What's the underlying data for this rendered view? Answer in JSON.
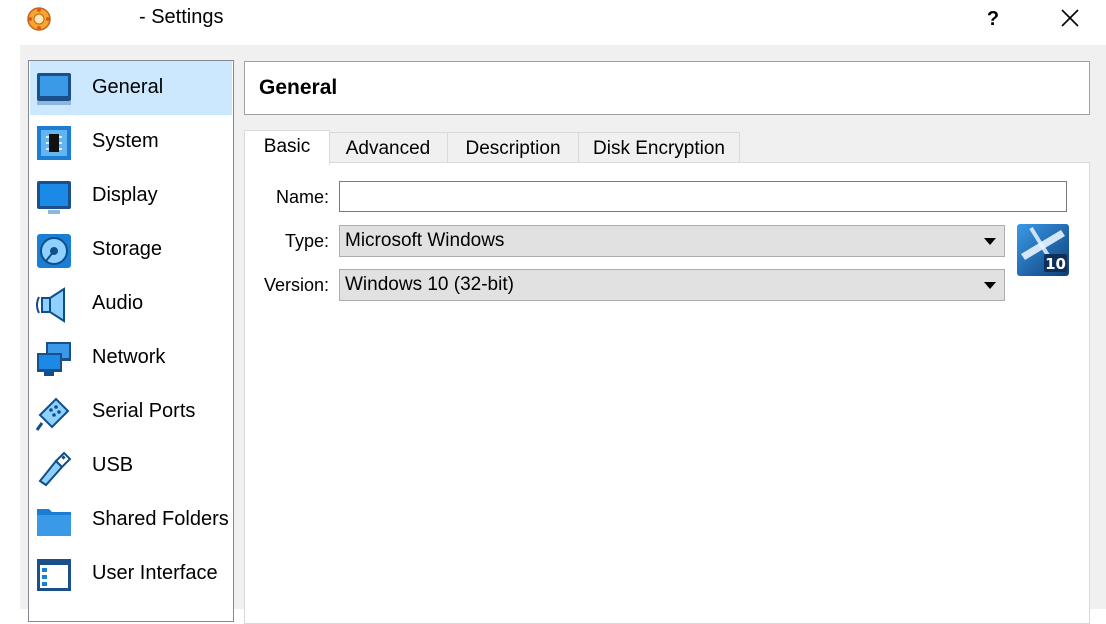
{
  "window": {
    "title": "- Settings",
    "help_label": "?",
    "icon": "virtualbox-icon"
  },
  "sidebar": {
    "items": [
      {
        "label": "General",
        "icon": "general-icon",
        "selected": true
      },
      {
        "label": "System",
        "icon": "system-chip-icon"
      },
      {
        "label": "Display",
        "icon": "display-monitor-icon"
      },
      {
        "label": "Storage",
        "icon": "storage-disk-icon"
      },
      {
        "label": "Audio",
        "icon": "audio-speaker-icon"
      },
      {
        "label": "Network",
        "icon": "network-icon"
      },
      {
        "label": "Serial Ports",
        "icon": "serial-ports-icon"
      },
      {
        "label": "USB",
        "icon": "usb-icon"
      },
      {
        "label": "Shared Folders",
        "icon": "shared-folder-icon"
      },
      {
        "label": "User Interface",
        "icon": "user-interface-icon"
      }
    ]
  },
  "page": {
    "title": "General"
  },
  "tabs": [
    {
      "label": "Basic",
      "active": true
    },
    {
      "label": "Advanced"
    },
    {
      "label": "Description"
    },
    {
      "label": "Disk Encryption"
    }
  ],
  "form": {
    "name_label": "Name:",
    "name_value": "",
    "type_label": "Type:",
    "type_value": "Microsoft Windows",
    "version_label": "Version:",
    "version_value": "Windows 10 (32-bit)",
    "os_badge_text": "10"
  },
  "colors": {
    "selection": "#cce8ff",
    "icon_blue": "#1a7fd4",
    "background": "#f0f0f0"
  }
}
